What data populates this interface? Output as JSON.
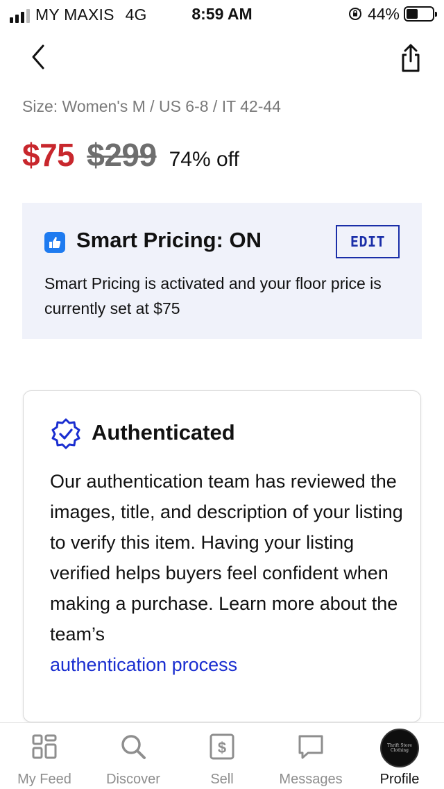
{
  "status_bar": {
    "carrier": "MY MAXIS",
    "network": "4G",
    "time": "8:59 AM",
    "battery_percent": "44%",
    "battery_level": 0.44,
    "signal_bars": 4,
    "signal_bars_filled": 3
  },
  "nav": {
    "back_icon": "chevron-left-icon",
    "share_icon": "share-icon"
  },
  "listing": {
    "size": "Size: Women's M / US 6-8 / IT 42-44",
    "price_current": "$75",
    "price_original": "$299",
    "discount": "74% off"
  },
  "smart_pricing": {
    "icon": "thumbs-up-icon",
    "title": "Smart Pricing: ON",
    "edit_label": "EDIT",
    "description": "Smart Pricing is activated and your floor price is currently set at $75"
  },
  "authenticated": {
    "icon": "verified-badge-icon",
    "title": "Authenticated",
    "body": "Our authentication team has reviewed the images, title, and description of your listing to verify this item. Having your listing verified helps buyers feel confident when making a purchase. Learn more about the team’s",
    "link_text": "authentication process"
  },
  "tab_bar": {
    "tabs": [
      {
        "label": "My Feed",
        "icon": "grid-icon",
        "active": false
      },
      {
        "label": "Discover",
        "icon": "search-icon",
        "active": false
      },
      {
        "label": "Sell",
        "icon": "dollar-tag-icon",
        "active": false
      },
      {
        "label": "Messages",
        "icon": "chat-bubble-icon",
        "active": false
      },
      {
        "label": "Profile",
        "icon": "avatar",
        "active": true
      }
    ],
    "avatar_text": "Thrift Store Clothing"
  },
  "colors": {
    "price_red": "#c8272d",
    "link_blue": "#1a2ed0",
    "edit_blue": "#1a2ea8",
    "panel_bg": "#f0f2fa",
    "badge_blue": "#1e7bf0"
  }
}
